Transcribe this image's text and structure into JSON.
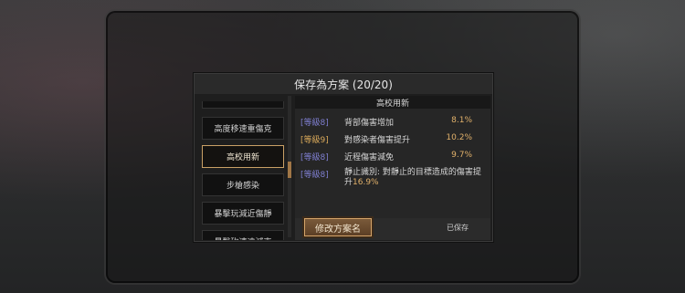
{
  "dialog": {
    "title": "保存為方案 (20/20)"
  },
  "schemes": [
    {
      "label": "高度移速重傷克",
      "selected": false
    },
    {
      "label": "高校用新",
      "selected": true
    },
    {
      "label": "步槍感染",
      "selected": false
    },
    {
      "label": "暴擊玩減近傷靜",
      "selected": false
    },
    {
      "label": "暴擊砍速遠減克",
      "selected": false
    }
  ],
  "detail": {
    "header": "高校用新",
    "stats": [
      {
        "tag": "[等級8]",
        "name": "背部傷害增加",
        "value": "8.1%"
      },
      {
        "tag": "[等級9]",
        "name": "對感染者傷害提升",
        "value": "10.2%"
      },
      {
        "tag": "[等級8]",
        "name": "近程傷害減免",
        "value": "9.7%"
      }
    ],
    "special": {
      "tag": "[等級8]",
      "text": "靜止識別: 對靜止的目標造成的傷害提升",
      "value": "16.9%"
    }
  },
  "footer": {
    "rename_label": "修改方案名",
    "saved_label": "已保存"
  },
  "colors": {
    "accent_gold": "#e0b06a",
    "tag_purple": "#7e7ecf",
    "tag_gold": "#d8a85a",
    "button_border": "#d6a56a"
  }
}
